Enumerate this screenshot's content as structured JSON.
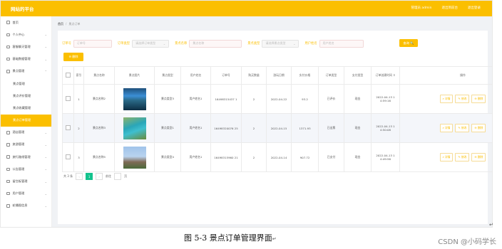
{
  "app": {
    "brand": "网站的平台",
    "top_links": [
      "管理员 admin",
      "退出到前台",
      "退出登录"
    ]
  },
  "sidebar": {
    "items": [
      {
        "label": "首页",
        "icon": "home-icon",
        "chev": ""
      },
      {
        "label": "个人中心",
        "icon": "user-icon",
        "chev": "⌄"
      },
      {
        "label": "客服聊天管理",
        "icon": "chat-icon",
        "chev": "⌄"
      },
      {
        "label": "基础数据管理",
        "icon": "grid-icon",
        "chev": "⌄"
      },
      {
        "label": "景点管理",
        "icon": "scenic-icon",
        "chev": "⌃"
      },
      {
        "label": "景点管理",
        "icon": "",
        "chev": "",
        "sub": true
      },
      {
        "label": "景点评价管理",
        "icon": "",
        "chev": "",
        "sub": true
      },
      {
        "label": "景点收藏管理",
        "icon": "",
        "chev": "",
        "sub": true
      },
      {
        "label": "景点订单管理",
        "icon": "",
        "chev": "",
        "sub": true,
        "active": true
      },
      {
        "label": "酒店管理",
        "icon": "hotel-icon",
        "chev": "⌄"
      },
      {
        "label": "旅游管理",
        "icon": "travel-icon",
        "chev": "⌄"
      },
      {
        "label": "旅行路线管理",
        "icon": "route-icon",
        "chev": "⌄"
      },
      {
        "label": "公告管理",
        "icon": "notice-icon",
        "chev": "⌄"
      },
      {
        "label": "留言板管理",
        "icon": "message-icon",
        "chev": "⌄"
      },
      {
        "label": "用户管理",
        "icon": "users-icon",
        "chev": "⌄"
      },
      {
        "label": "轮播图信息",
        "icon": "carousel-icon",
        "chev": "⌄"
      }
    ]
  },
  "breadcrumb": {
    "home": "首页",
    "sep": "/",
    "current": "景点订单"
  },
  "filters": [
    {
      "label": "订单号",
      "placeholder": "订单号",
      "type": "input",
      "w": 54
    },
    {
      "label": "订单类型",
      "placeholder": "请选择订单类型",
      "type": "select",
      "w": 52
    },
    {
      "label": "景点名称",
      "placeholder": "景点名称",
      "type": "input",
      "w": 74
    },
    {
      "label": "景点类型",
      "placeholder": "请选择景点类型",
      "type": "select",
      "w": 52
    },
    {
      "label": "用户姓名",
      "placeholder": "用户姓名",
      "type": "input",
      "w": 62
    }
  ],
  "search_button": "查询 🔍",
  "delete_button": "⊖ 删除",
  "table": {
    "headers": [
      "",
      "索引",
      "景点名称",
      "景点图片",
      "景点类型",
      "用户姓名",
      "订单号",
      "购买数量",
      "游玩日期",
      "实付价格",
      "订单类型",
      "支付类型",
      "订单创建时间 ⇕",
      "操作"
    ],
    "rows": [
      {
        "index": "1",
        "name": "景点名称2",
        "img": "t1",
        "type": "景点类型3",
        "user": "用户姓名1",
        "order": "16498315437 1",
        "qty": "2",
        "date": "2022-04-22",
        "price": "93.2",
        "otype": "已评价",
        "pay": "现金",
        "created": "2022-04-13 1 4:59:16"
      },
      {
        "index": "2",
        "name": "景点名称3",
        "img": "t2",
        "type": "景点类型1",
        "user": "用户姓名1",
        "order": "16498320076 25",
        "qty": "2",
        "date": "2022-04-15",
        "price": "1371.93",
        "otype": "已出票",
        "pay": "现金",
        "created": "2022-04-13 1 4:50:08"
      },
      {
        "index": "3",
        "name": "景点名称5",
        "img": "t3",
        "type": "景点类型4",
        "user": "用户姓名1",
        "order": "16498315960 21",
        "qty": "2",
        "date": "2022-04-14",
        "price": "907.72",
        "otype": "已支付",
        "pay": "现金",
        "created": "2022-04-13 1 4:49:56"
      }
    ],
    "actions": [
      "⌕ 详情",
      "✎ 修改",
      "⊖ 删除"
    ]
  },
  "pager": {
    "total": "共 3 条",
    "prev": "‹",
    "page": "1",
    "next": "›",
    "goto": "前往",
    "unit": "页"
  },
  "caption": "图 5-3 景点订单管理界面",
  "watermark": "CSDN @小码学长"
}
